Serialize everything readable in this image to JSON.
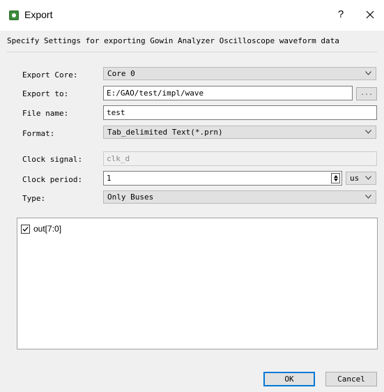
{
  "window": {
    "title": "Export",
    "help_label": "?",
    "icon": "app-icon"
  },
  "description": "Specify Settings for exporting Gowin Analyzer Oscilloscope waveform data",
  "form": {
    "export_core": {
      "label": "Export Core:",
      "value": "Core 0"
    },
    "export_to": {
      "label": "Export to:",
      "value": "E:/GAO/test/impl/wave",
      "browse_label": "..."
    },
    "file_name": {
      "label": "File name:",
      "value": "test"
    },
    "format": {
      "label": "Format:",
      "value": "Tab_delimited Text(*.prn)"
    },
    "clock_signal": {
      "label": "Clock signal:",
      "value": "clk_d"
    },
    "clock_period": {
      "label": "Clock period:",
      "value": "1",
      "unit": "us"
    },
    "type": {
      "label": "Type:",
      "value": "Only Buses"
    }
  },
  "signals": [
    {
      "label": "out[7:0]",
      "checked": true
    }
  ],
  "buttons": {
    "ok": "OK",
    "cancel": "Cancel"
  },
  "colors": {
    "accent": "#0078d7",
    "background": "#f0f0f0",
    "control": "#e1e1e1"
  }
}
